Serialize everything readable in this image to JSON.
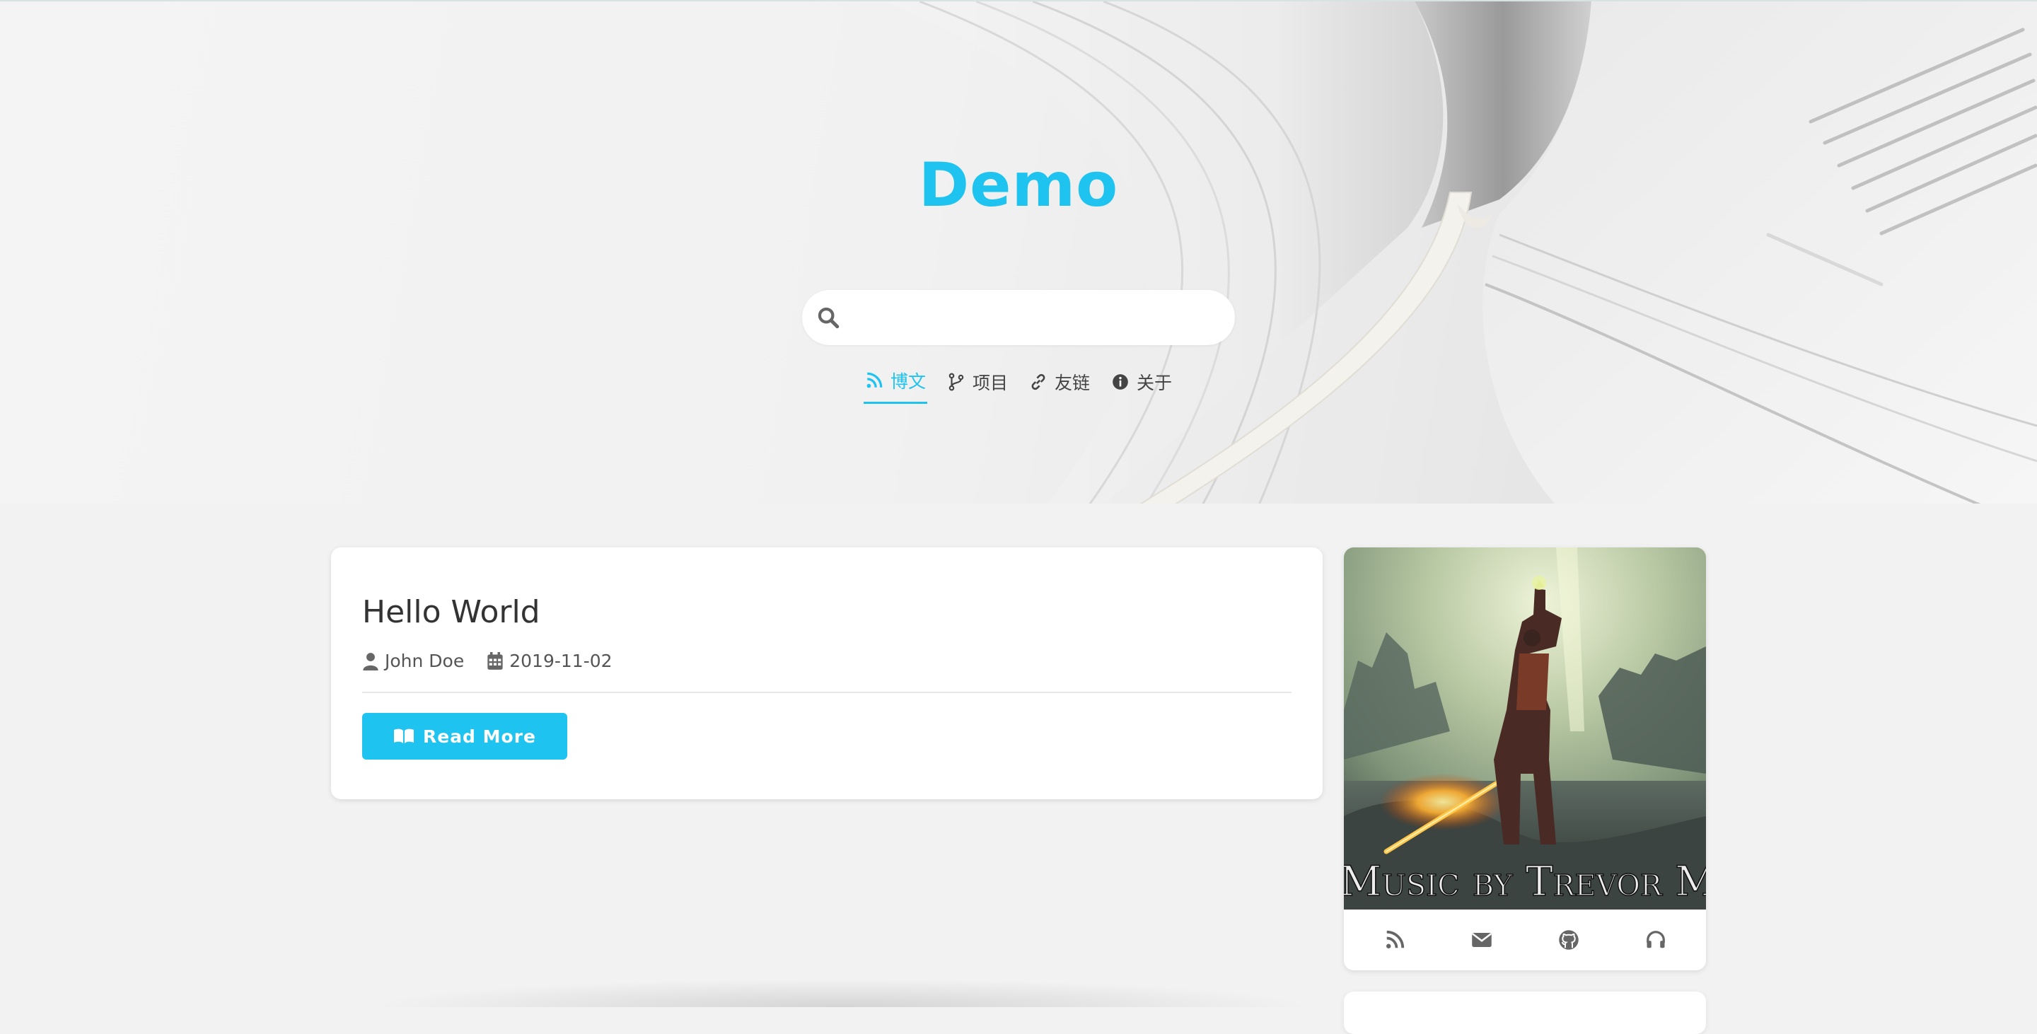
{
  "site": {
    "title": "Demo"
  },
  "search": {
    "placeholder": "",
    "value": ""
  },
  "nav": {
    "items": [
      {
        "label": "博文",
        "icon": "rss-icon",
        "active": true
      },
      {
        "label": "项目",
        "icon": "code-branch-icon",
        "active": false
      },
      {
        "label": "友链",
        "icon": "link-icon",
        "active": false
      },
      {
        "label": "关于",
        "icon": "info-circle-icon",
        "active": false
      }
    ]
  },
  "post": {
    "title": "Hello World",
    "author": "John Doe",
    "date": "2019-11-02",
    "read_more_label": "Read More"
  },
  "sidebar": {
    "album_caption": "Music by Trevor Morris",
    "icons": [
      "rss-icon",
      "envelope-icon",
      "github-icon",
      "headphones-icon"
    ]
  },
  "colors": {
    "accent": "#1ec3f0",
    "background": "#f2f2f2",
    "card": "#ffffff"
  }
}
